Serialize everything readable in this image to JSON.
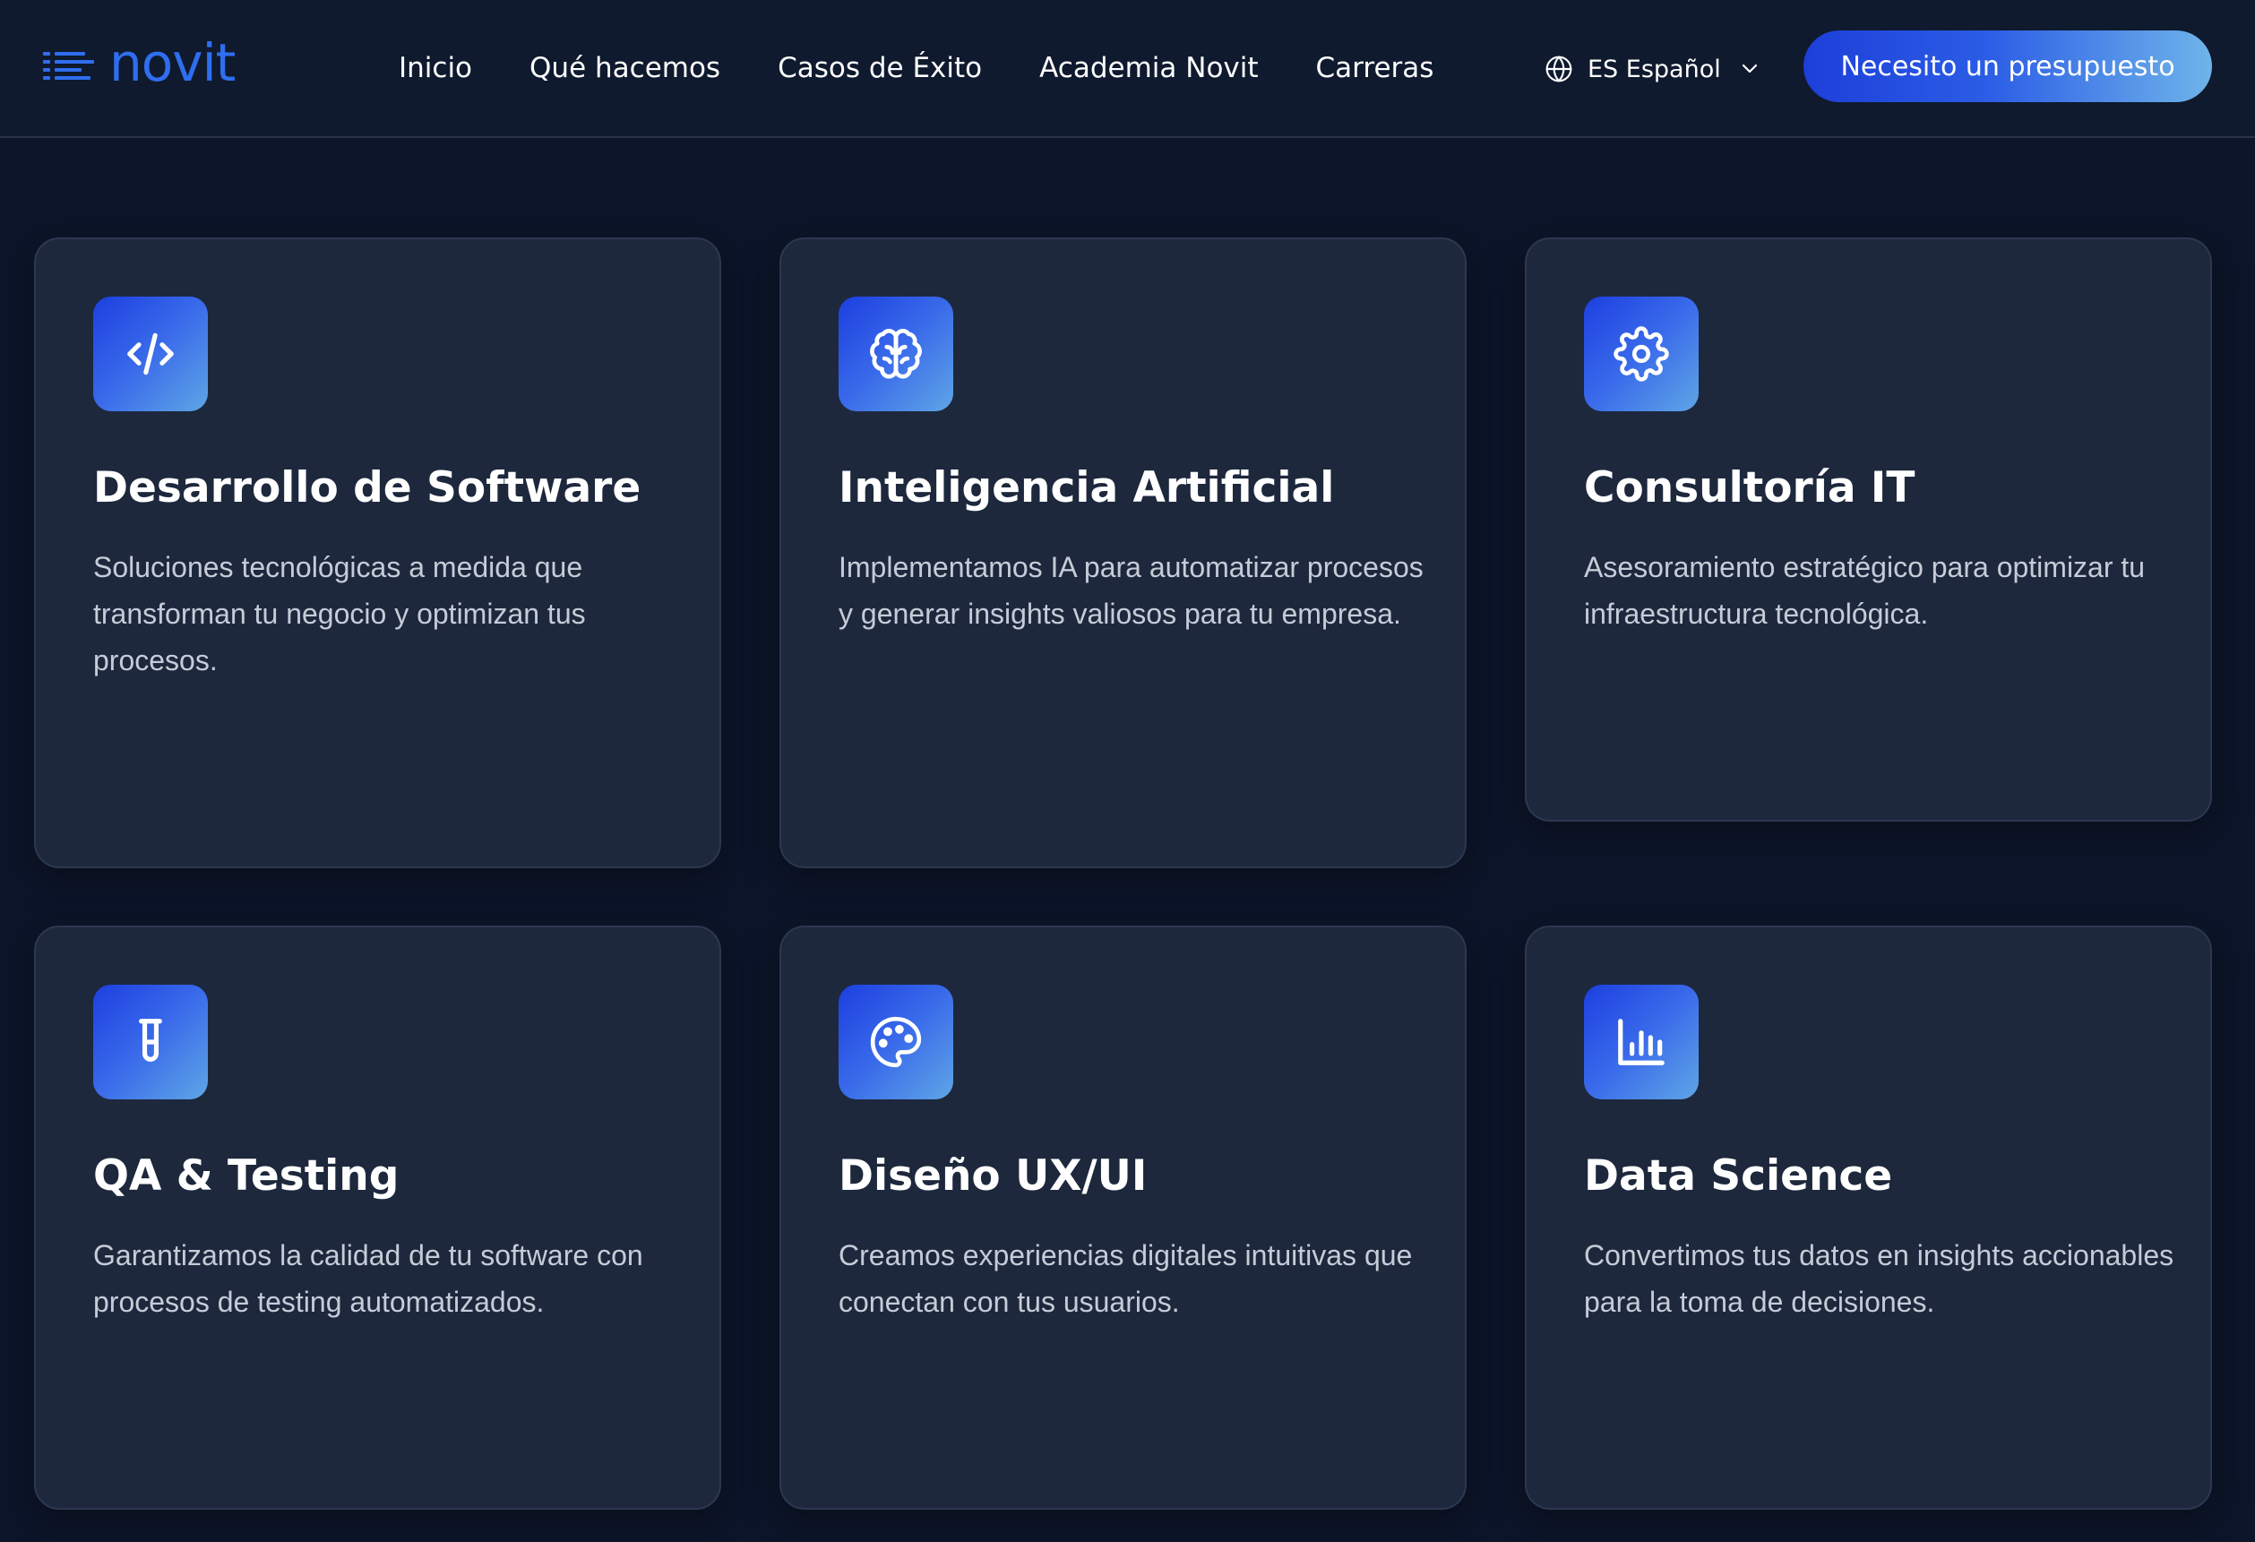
{
  "header": {
    "logo_text": "novit",
    "nav": [
      {
        "label": "Inicio"
      },
      {
        "label": "Qué hacemos"
      },
      {
        "label": "Casos de Éxito"
      },
      {
        "label": "Academia Novit"
      },
      {
        "label": "Carreras"
      }
    ],
    "language": {
      "label": "ES Español",
      "icon": "globe-icon"
    },
    "cta_label": "Necesito un presupuesto"
  },
  "colors": {
    "background": "#0c1529",
    "header_bg": "#0f1a2e",
    "card_bg": "#1d283d",
    "accent": "#2f6ef0",
    "gradient_start": "#1d3fd9",
    "gradient_end": "#6fb4ea"
  },
  "services": [
    {
      "icon": "code-icon",
      "title": "Desarrollo de Software",
      "description": "Soluciones tecnológicas a medida que transforman tu negocio y optimizan tus procesos."
    },
    {
      "icon": "brain-icon",
      "title": "Inteligencia Artificial",
      "description": "Implementamos IA para automatizar procesos y generar insights valiosos para tu empresa."
    },
    {
      "icon": "gear-icon",
      "title": "Consultoría IT",
      "description": "Asesoramiento estratégico para optimizar tu infraestructura tecnológica."
    },
    {
      "icon": "test-tube-icon",
      "title": "QA & Testing",
      "description": "Garantizamos la calidad de tu software con procesos de testing automatizados."
    },
    {
      "icon": "palette-icon",
      "title": "Diseño UX/UI",
      "description": "Creamos experiencias digitales intuitivas que conectan con tus usuarios."
    },
    {
      "icon": "bar-chart-icon",
      "title": "Data Science",
      "description": "Convertimos tus datos en insights accionables para la toma de decisiones."
    }
  ]
}
